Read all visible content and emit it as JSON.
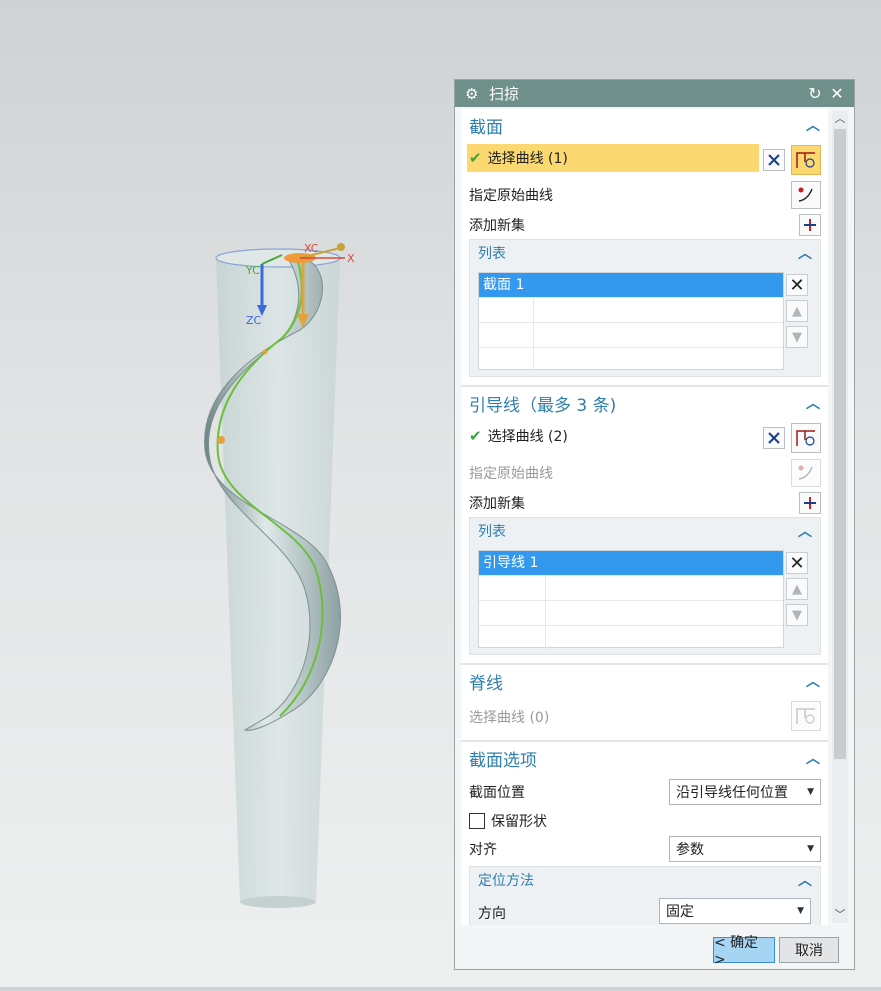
{
  "viewport": {
    "axis_labels": {
      "xc": "XC",
      "x": "X",
      "yc": "YC",
      "zc": "ZC"
    }
  },
  "dialog": {
    "title": "扫掠",
    "section": {
      "title": "截面",
      "select_curve": "选择曲线 (1)",
      "specify_original": "指定原始曲线",
      "add_new_set": "添加新集",
      "list_title": "列表",
      "list_items": [
        "截面 1"
      ]
    },
    "guides": {
      "title": "引导线（最多 3 条)",
      "select_curve": "选择曲线 (2)",
      "specify_original": "指定原始曲线",
      "add_new_set": "添加新集",
      "list_title": "列表",
      "list_items": [
        "引导线 1"
      ]
    },
    "spine": {
      "title": "脊线",
      "select_curve": "选择曲线 (0)"
    },
    "section_options": {
      "title": "截面选项",
      "position_label": "截面位置",
      "position_value": "沿引导线任何位置",
      "keep_shape": "保留形状",
      "align_label": "对齐",
      "align_value": "参数",
      "positioning": {
        "title": "定位方法",
        "direction_label": "方向",
        "direction_value": "固定"
      }
    },
    "footer": {
      "ok": "< 确定 >",
      "cancel": "取消"
    }
  },
  "colors": {
    "title_bar": "#6f8f8a",
    "section_header": "#2f7fae",
    "selected_row": "#fcd870",
    "list_selection": "#3399ee",
    "ok_button": "#a6d4f3"
  }
}
